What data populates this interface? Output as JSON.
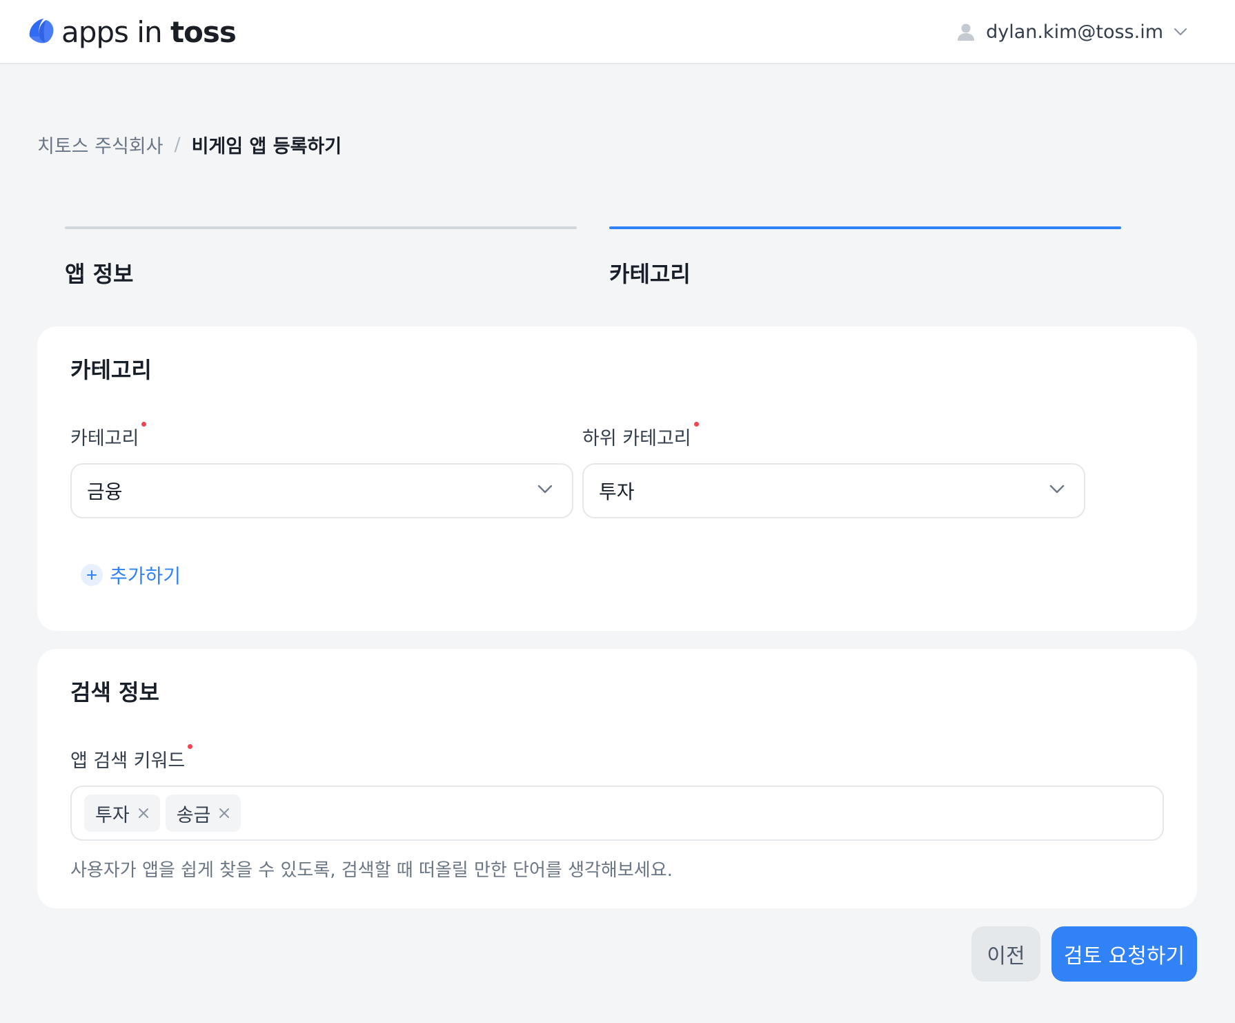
{
  "header": {
    "logo_light": "apps in",
    "logo_bold": "toss",
    "account_email": "dylan.kim@toss.im",
    "icons": [
      "logo-icon",
      "avatar-icon",
      "chevron-down-icon"
    ]
  },
  "breadcrumb": {
    "org": "치토스 주식회사",
    "separator": "/",
    "current": "비게임 앱 등록하기"
  },
  "stepper": {
    "steps": [
      {
        "label": "앱 정보",
        "active": false,
        "color": "#d1d6db"
      },
      {
        "label": "카테고리",
        "active": true,
        "color": "#3182f6"
      }
    ]
  },
  "category_card": {
    "title": "카테고리",
    "category_label": "카테고리",
    "category_value": "금융",
    "subcategory_label": "하위 카테고리",
    "subcategory_value": "투자",
    "add_label": "추가하기"
  },
  "search_card": {
    "title": "검색 정보",
    "keywords_label": "앱 검색 키워드",
    "keywords": [
      "투자",
      "송금"
    ],
    "helper": "사용자가 앱을 쉽게 찾을 수 있도록, 검색할 때 떠올릴 만한 단어를 생각해보세요."
  },
  "footer": {
    "prev_label": "이전",
    "submit_label": "검토 요청하기"
  },
  "colors": {
    "accent": "#3182f6",
    "required_dot": "#f04452",
    "background": "#f4f5f7"
  }
}
